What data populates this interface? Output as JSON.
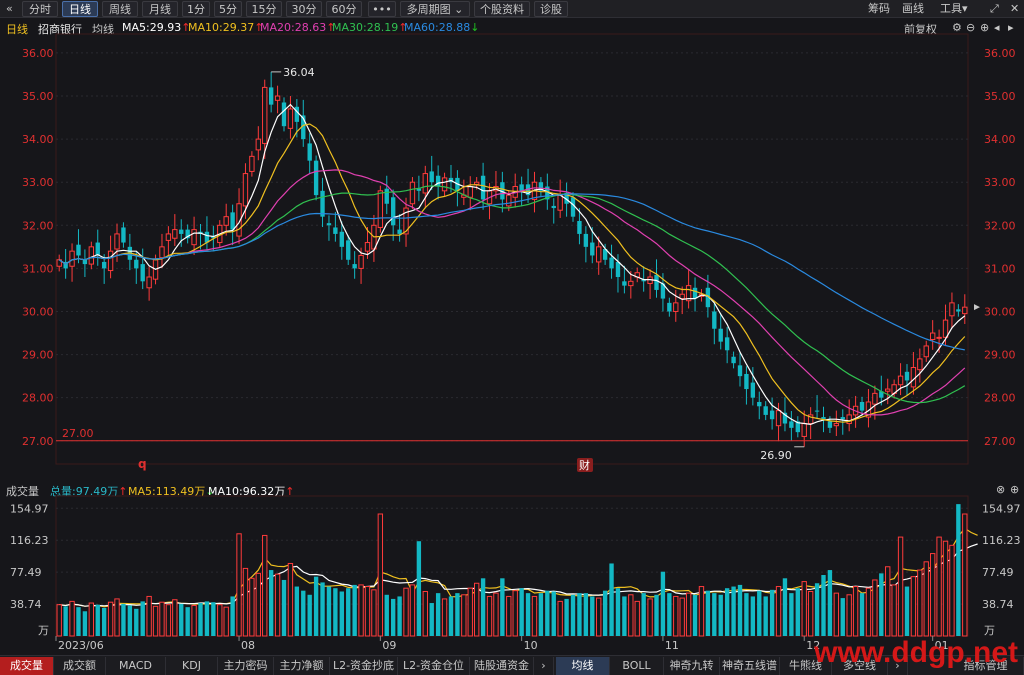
{
  "toolbar": {
    "back_icon": "«",
    "periods": [
      "分时",
      "日线",
      "周线",
      "月线",
      "1分",
      "5分",
      "15分",
      "30分",
      "60分"
    ],
    "active_period": "日线",
    "more_label": "•••",
    "multi_period": "多周期图",
    "profile": "个股资料",
    "diagnose": "诊股",
    "right": [
      "筹码",
      "画线",
      "工具"
    ]
  },
  "main_info": {
    "period": "日线",
    "stock_name": "招商银行",
    "avg_label": "均线",
    "ma": [
      {
        "label": "MA5:29.93",
        "color": "#ffffff"
      },
      {
        "label": "MA10:29.37",
        "color": "#f0c020"
      },
      {
        "label": "MA20:28.63",
        "color": "#e040b0"
      },
      {
        "label": "MA30:28.19",
        "color": "#30c050"
      },
      {
        "label": "MA60:28.88",
        "color": "#2a8ae0"
      }
    ],
    "adjust": "前复权"
  },
  "vol_info": {
    "label": "成交量",
    "total": "总量:97.49万",
    "ma5": "MA5:113.49万",
    "ma10": "MA10:96.32万"
  },
  "chart_data": {
    "type": "candlestick",
    "price_axis": {
      "min": 26.6,
      "max": 36.3,
      "ticks": [
        "36.00",
        "35.00",
        "34.00",
        "33.00",
        "32.00",
        "31.00",
        "30.00",
        "29.00",
        "28.00",
        "27.00"
      ]
    },
    "volume_axis": {
      "min": 0,
      "max": 165,
      "ticks": [
        "154.97",
        "116.23",
        "77.49",
        "38.74"
      ],
      "unit": "万"
    },
    "x_labels": [
      "2023/06",
      "08",
      "09",
      "10",
      "11",
      "12",
      "01"
    ],
    "annotations": {
      "high": "36.04",
      "low": "26.90",
      "line_label": "27.00",
      "line_value": 27.0,
      "marker_q": "q",
      "marker_cai": "财"
    },
    "closes": [
      31.2,
      31.0,
      31.4,
      31.3,
      31.1,
      31.5,
      31.3,
      31.0,
      31.4,
      31.8,
      31.6,
      31.2,
      31.0,
      30.7,
      30.8,
      31.2,
      31.5,
      31.8,
      31.9,
      31.8,
      31.7,
      31.9,
      31.8,
      31.6,
      31.7,
      32.0,
      32.2,
      31.9,
      32.5,
      33.2,
      33.6,
      34.0,
      35.2,
      34.8,
      35.0,
      34.3,
      34.7,
      34.4,
      34.0,
      33.5,
      32.7,
      32.2,
      32.0,
      31.8,
      31.5,
      31.2,
      31.0,
      31.3,
      31.6,
      32.0,
      32.8,
      32.5,
      32.0,
      31.8,
      32.4,
      33.0,
      32.8,
      33.2,
      33.0,
      32.9,
      33.1,
      33.0,
      32.8,
      32.7,
      32.9,
      33.0,
      32.6,
      32.8,
      32.9,
      32.6,
      32.7,
      32.9,
      32.8,
      32.7,
      33.0,
      32.8,
      32.6,
      32.4,
      32.7,
      32.5,
      32.2,
      31.8,
      31.5,
      31.3,
      31.5,
      31.2,
      31.0,
      30.8,
      30.6,
      30.7,
      30.9,
      30.7,
      30.8,
      30.5,
      30.3,
      30.0,
      30.2,
      30.4,
      30.6,
      30.3,
      30.4,
      30.1,
      29.6,
      29.3,
      29.1,
      28.8,
      28.5,
      28.2,
      28.0,
      27.8,
      27.6,
      27.5,
      27.7,
      27.4,
      27.3,
      27.2,
      27.4,
      27.6,
      27.7,
      27.5,
      27.3,
      27.4,
      27.5,
      27.6,
      27.8,
      27.7,
      27.9,
      28.1,
      28.0,
      28.2,
      28.3,
      28.5,
      28.4,
      28.7,
      28.9,
      29.2,
      29.5,
      29.4,
      29.8,
      30.2,
      30.0,
      30.1
    ],
    "volumes": [
      38,
      36,
      42,
      35,
      30,
      40,
      38,
      34,
      41,
      45,
      39,
      37,
      33,
      42,
      48,
      36,
      41,
      38,
      44,
      39,
      35,
      37,
      40,
      42,
      41,
      38,
      35,
      48,
      124,
      82,
      70,
      76,
      122,
      80,
      75,
      68,
      88,
      60,
      55,
      50,
      72,
      65,
      60,
      58,
      54,
      58,
      62,
      62,
      60,
      56,
      148,
      50,
      45,
      48,
      58,
      62,
      115,
      54,
      40,
      52,
      45,
      48,
      52,
      50,
      58,
      64,
      70,
      48,
      52,
      70,
      48,
      55,
      58,
      52,
      48,
      52,
      55,
      54,
      42,
      45,
      50,
      52,
      52,
      48,
      46,
      55,
      88,
      58,
      48,
      50,
      42,
      52,
      45,
      50,
      78,
      52,
      48,
      46,
      52,
      50,
      60,
      55,
      52,
      50,
      58,
      60,
      62,
      52,
      48,
      55,
      48,
      56,
      60,
      70,
      52,
      58,
      66,
      54,
      64,
      74,
      80,
      52,
      46,
      50,
      60,
      52,
      58,
      68,
      76,
      84,
      62,
      120,
      60,
      72,
      80,
      90,
      100,
      120,
      115,
      110,
      160,
      148,
      95,
      98
    ]
  }
}
